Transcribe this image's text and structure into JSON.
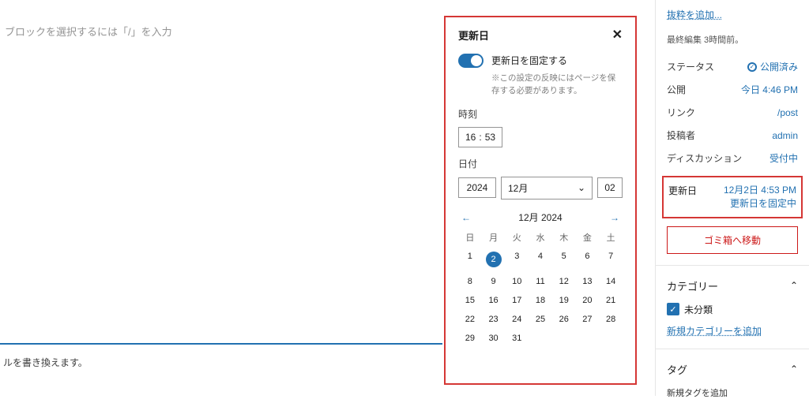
{
  "editor": {
    "placeholder": "ブロックを選択するには「/」を入力",
    "bottom_hint_suffix": "ルを書き換えます。"
  },
  "popover": {
    "title": "更新日",
    "close": "✕",
    "toggle_label": "更新日を固定する",
    "toggle_note": "※この設定の反映にはページを保存する必要があります。",
    "time_label": "時刻",
    "time_hh": "16",
    "time_sep": ":",
    "time_mm": "53",
    "date_label": "日付",
    "year": "2024",
    "month": "12月",
    "day": "02",
    "cal_title": "12月 2024",
    "dows": [
      "日",
      "月",
      "火",
      "水",
      "木",
      "金",
      "土"
    ],
    "weeks": [
      [
        {
          "n": 1
        },
        {
          "n": 2,
          "sel": true
        },
        {
          "n": 3
        },
        {
          "n": 4
        },
        {
          "n": 5
        },
        {
          "n": 6
        },
        {
          "n": 7
        }
      ],
      [
        {
          "n": 8
        },
        {
          "n": 9
        },
        {
          "n": 10
        },
        {
          "n": 11
        },
        {
          "n": 12
        },
        {
          "n": 13
        },
        {
          "n": 14
        }
      ],
      [
        {
          "n": 15
        },
        {
          "n": 16
        },
        {
          "n": 17
        },
        {
          "n": 18
        },
        {
          "n": 19
        },
        {
          "n": 20
        },
        {
          "n": 21
        }
      ],
      [
        {
          "n": 22
        },
        {
          "n": 23
        },
        {
          "n": 24
        },
        {
          "n": 25
        },
        {
          "n": 26
        },
        {
          "n": 27
        },
        {
          "n": 28
        }
      ],
      [
        {
          "n": 29
        },
        {
          "n": 30
        },
        {
          "n": 31
        },
        {
          "n": "",
          "other": true
        },
        {
          "n": "",
          "other": true
        },
        {
          "n": "",
          "other": true
        },
        {
          "n": "",
          "other": true
        }
      ]
    ]
  },
  "sidebar": {
    "add_excerpt": "抜粋を追加...",
    "last_edit": "最終編集 3時間前。",
    "rows": {
      "status_k": "ステータス",
      "status_v": "公開済み",
      "publish_k": "公開",
      "publish_v": "今日 4:46 PM",
      "link_k": "リンク",
      "link_v": "/post",
      "author_k": "投稿者",
      "author_v": "admin",
      "discussion_k": "ディスカッション",
      "discussion_v": "受付中"
    },
    "update_k": "更新日",
    "update_v1": "12月2日 4:53 PM",
    "update_v2": "更新日を固定中",
    "trash": "ゴミ箱へ移動",
    "cat_title": "カテゴリー",
    "cat_item": "未分類",
    "add_cat": "新規カテゴリーを追加",
    "tag_title": "タグ",
    "tag_add": "新規タグを追加"
  }
}
